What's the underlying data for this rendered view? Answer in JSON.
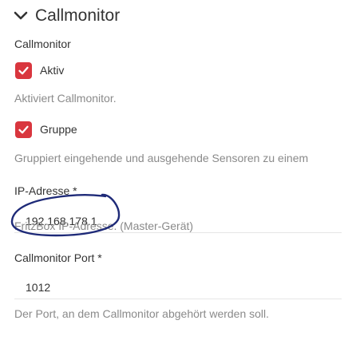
{
  "header": {
    "title": "Callmonitor"
  },
  "section": {
    "label": "Callmonitor"
  },
  "aktiv": {
    "label": "Aktiv",
    "checked": true,
    "help": "Aktiviert Callmonitor."
  },
  "gruppe": {
    "label": "Gruppe",
    "checked": true,
    "help": "Gruppiert eingehende und ausgehende Sensoren zu einem"
  },
  "ip": {
    "label": "IP-Adresse *",
    "value": "192.168.178.1",
    "help": "FritzBox IP-Adresse. (Master-Gerät)"
  },
  "port": {
    "label": "Callmonitor Port *",
    "value": "1012",
    "help": "Der Port, an dem Callmonitor abgehört werden soll."
  },
  "colors": {
    "checkbox": "#d9363e",
    "annotation": "#1e2a78",
    "help_text": "#8a8a8a"
  },
  "icons": {
    "header": "chevron-down-icon",
    "checkbox": "checkmark-icon"
  }
}
